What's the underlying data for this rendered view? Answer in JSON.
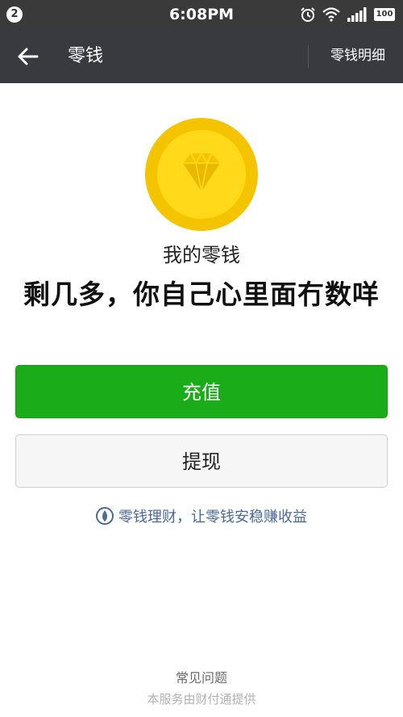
{
  "status_bar": {
    "notification_count": "2",
    "time": "6:08PM",
    "battery": "100"
  },
  "nav": {
    "title": "零钱",
    "detail_link": "零钱明细"
  },
  "main": {
    "label": "我的零钱",
    "caption": "剩几多，你自己心里面冇数咩"
  },
  "buttons": {
    "recharge": "充值",
    "withdraw": "提现"
  },
  "licai_link": "零钱理财，让零钱安稳赚收益",
  "footer": {
    "faq": "常见问题",
    "provider": "本服务由财付通提供"
  },
  "colors": {
    "accent_green": "#1aad19",
    "nav_bg": "#393a3f",
    "coin_yellow": "#f5c400",
    "link_blue": "#4a6a9b"
  },
  "icons": [
    "back-arrow-icon",
    "alarm-icon",
    "wifi-icon",
    "signal-icon",
    "battery-icon",
    "diamond-icon",
    "licai-drop-icon"
  ]
}
